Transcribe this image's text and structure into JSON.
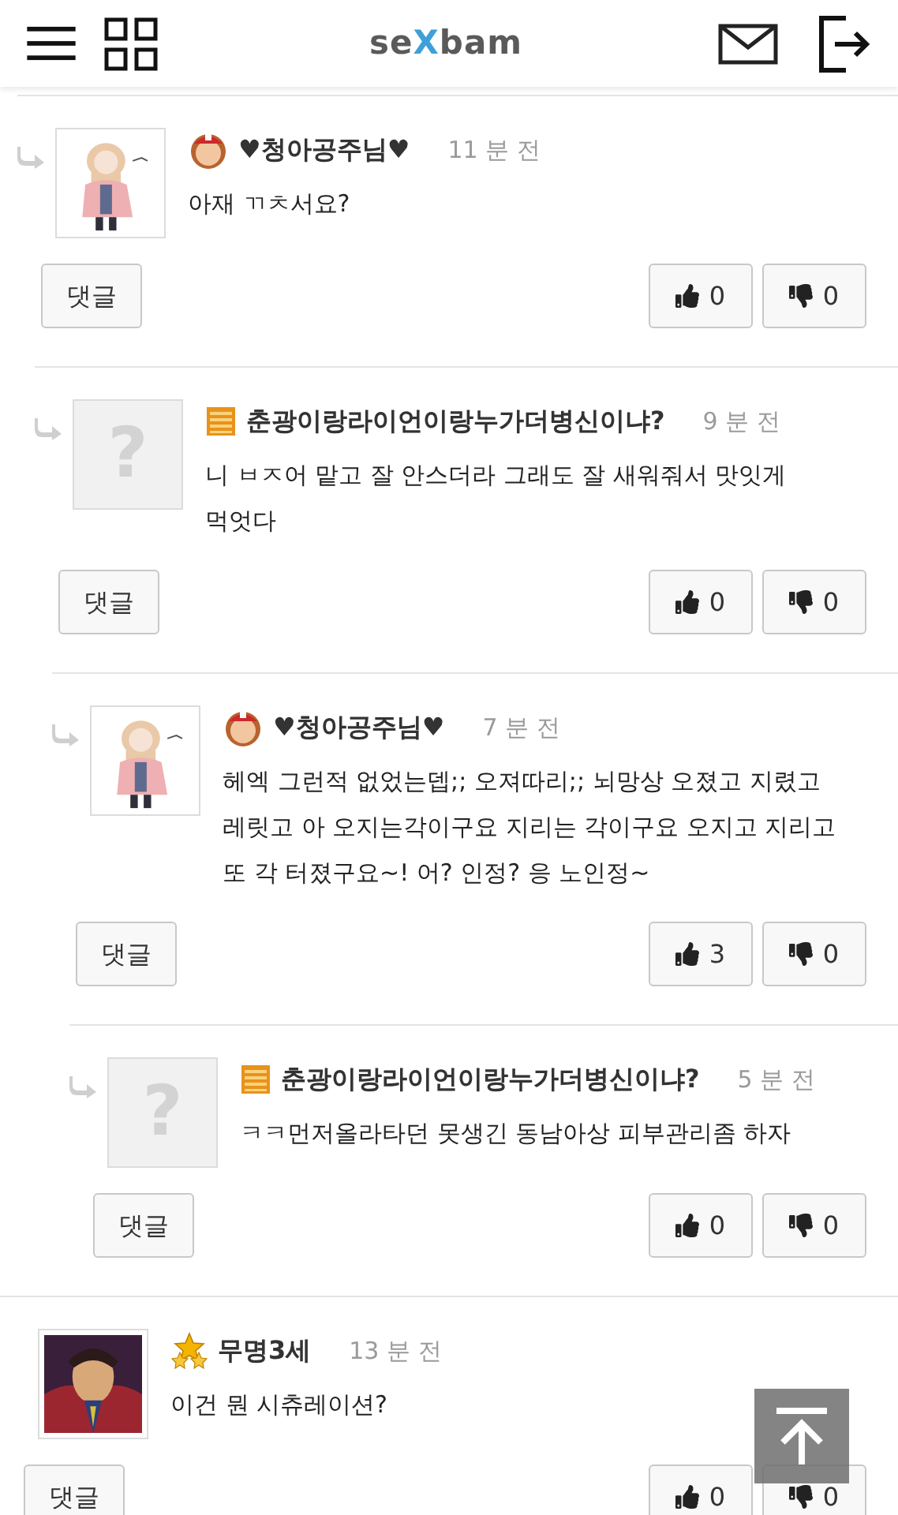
{
  "header": {
    "logo": [
      {
        "text": "se",
        "color": "#5a5a5a"
      },
      {
        "text": "X",
        "color": "#3ea0d8"
      },
      {
        "text": "bam",
        "color": "#5a5a5a"
      }
    ]
  },
  "comments": [
    {
      "reply": true,
      "avatar": {
        "kind": "picture"
      },
      "badge": {
        "kind": "face"
      },
      "author": "♥청아공주님♥",
      "time": "11 분 전",
      "body": "아재 ㄲㅊ서요?",
      "reply_button": "댓글",
      "likes": "0",
      "dislikes": "0",
      "children": [
        {
          "reply": true,
          "avatar": {
            "kind": "placeholder",
            "mark": "?"
          },
          "badge": {
            "kind": "bars"
          },
          "author": "춘광이랑라이언이랑누가더병신이냐?",
          "time": "9 분 전",
          "body": "니 ㅂㅈ어 맡고 잘 안스더라 그래도 잘 새워줘서 맛잇게 먹엇다",
          "reply_button": "댓글",
          "likes": "0",
          "dislikes": "0",
          "children": [
            {
              "reply": true,
              "avatar": {
                "kind": "picture"
              },
              "badge": {
                "kind": "face"
              },
              "author": "♥청아공주님♥",
              "time": "7 분 전",
              "body": "헤엑 그런적 없었는뎁;; 오져따리;; 뇌망상 오졌고 지렸고 레릿고 아 오지는각이구요 지리는 각이구요 오지고 지리고 또 각 터졌구요~! 어? 인정? 응 노인정~",
              "reply_button": "댓글",
              "likes": "3",
              "dislikes": "0",
              "children": [
                {
                  "reply": true,
                  "avatar": {
                    "kind": "placeholder",
                    "mark": "?"
                  },
                  "badge": {
                    "kind": "bars"
                  },
                  "author": "춘광이랑라이언이랑누가더병신이냐?",
                  "time": "5 분 전",
                  "body": "ㅋㅋ먼저올라타던 못생긴 동남아상 피부관리좀 하자",
                  "reply_button": "댓글",
                  "likes": "0",
                  "dislikes": "0"
                }
              ]
            }
          ]
        }
      ]
    },
    {
      "reply": false,
      "avatar": {
        "kind": "picture"
      },
      "badge": {
        "kind": "stars"
      },
      "author": "무명3세",
      "time": "13 분 전",
      "body": "이건 뭔 시츄레이션?",
      "reply_button": "댓글",
      "likes": "0",
      "dislikes": "0"
    }
  ]
}
